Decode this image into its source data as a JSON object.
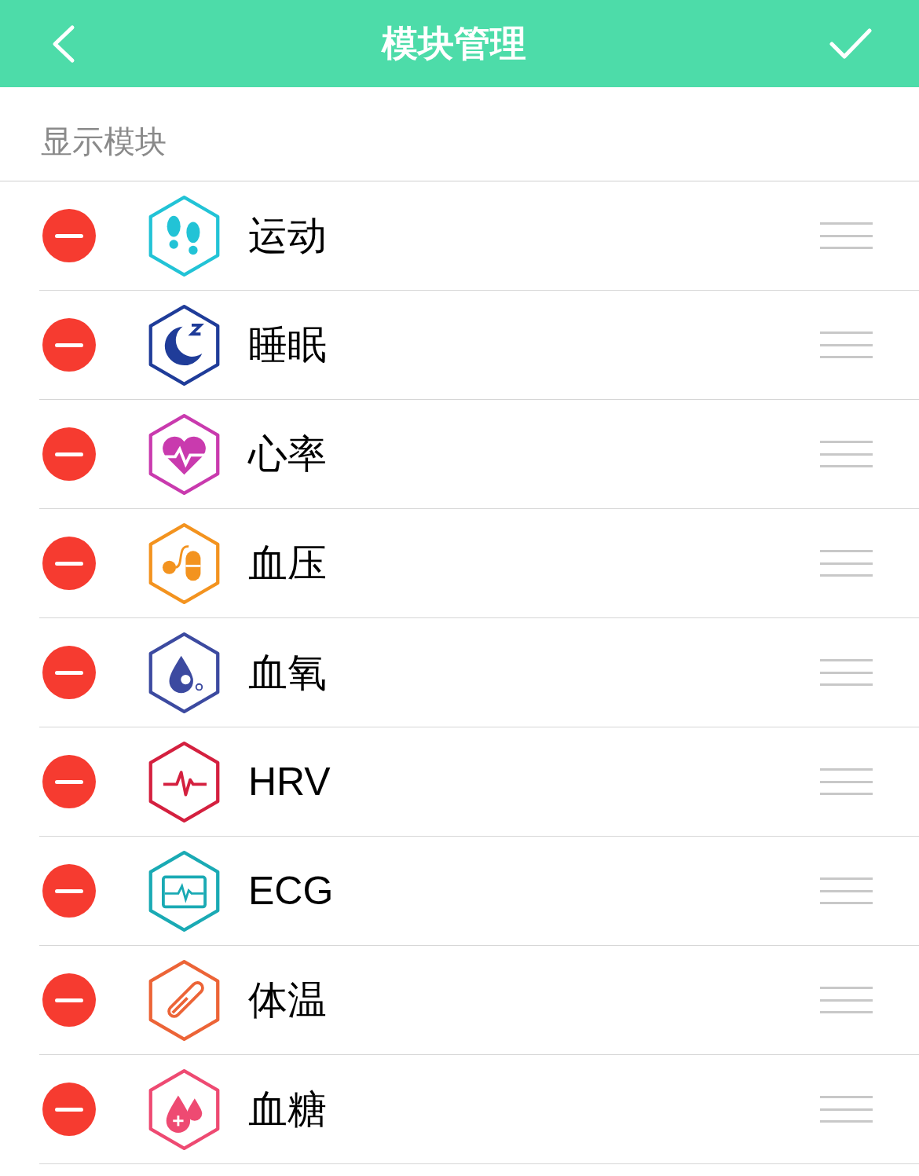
{
  "header": {
    "title": "模块管理"
  },
  "section": {
    "label": "显示模块"
  },
  "modules": [
    {
      "label": "运动",
      "kind": "steps",
      "color": "#22c3d6"
    },
    {
      "label": "睡眠",
      "kind": "sleep",
      "color": "#1f3c99"
    },
    {
      "label": "心率",
      "kind": "heart",
      "color": "#c93aae"
    },
    {
      "label": "血压",
      "kind": "pressure",
      "color": "#f3931f"
    },
    {
      "label": "血氧",
      "kind": "oxygen",
      "color": "#3c4aa0"
    },
    {
      "label": "HRV",
      "kind": "hrv",
      "color": "#d4203f"
    },
    {
      "label": "ECG",
      "kind": "ecg",
      "color": "#1aaab4"
    },
    {
      "label": "体温",
      "kind": "thermometer",
      "color": "#ec6437"
    },
    {
      "label": "血糖",
      "kind": "glucose",
      "color": "#ee4a72"
    }
  ]
}
